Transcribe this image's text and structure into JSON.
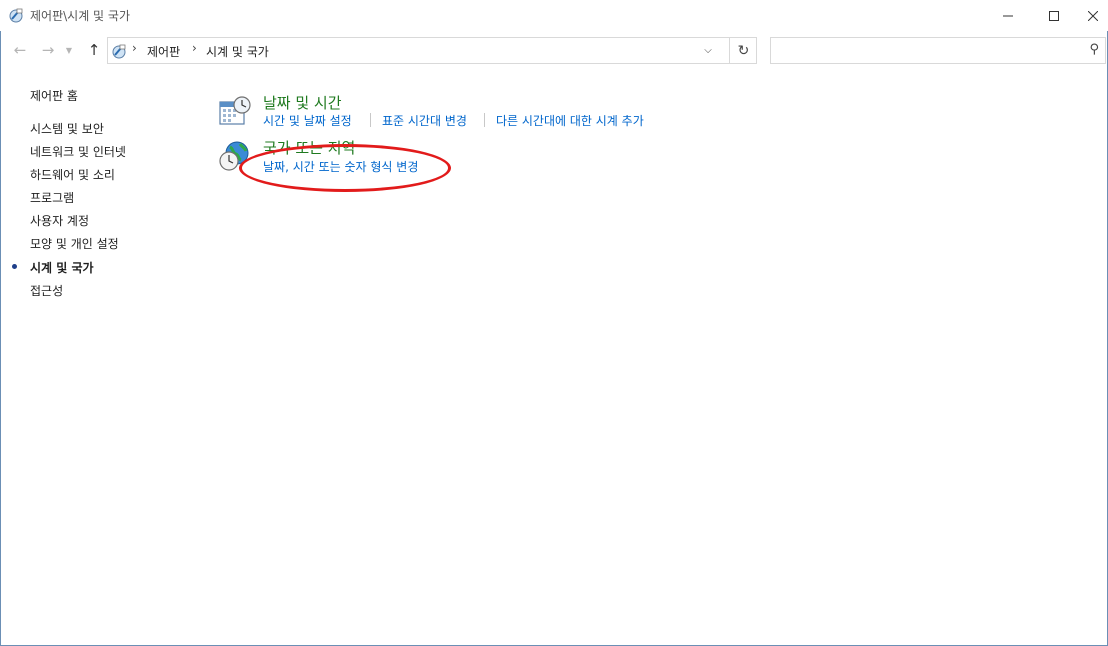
{
  "window": {
    "title": "제어판\\시계 및 국가"
  },
  "address": {
    "crumbs": [
      "제어판",
      "시계 및 국가"
    ],
    "separator": "›"
  },
  "search": {
    "placeholder": ""
  },
  "sidebar": {
    "home": "제어판 홈",
    "items": [
      {
        "label": "시스템 및 보안"
      },
      {
        "label": "네트워크 및 인터넷"
      },
      {
        "label": "하드웨어 및 소리"
      },
      {
        "label": "프로그램"
      },
      {
        "label": "사용자 계정"
      },
      {
        "label": "모양 및 개인 설정"
      },
      {
        "label": "시계 및 국가",
        "current": true
      },
      {
        "label": "접근성"
      }
    ]
  },
  "categories": [
    {
      "title": "날짜 및 시간",
      "icon": "calendar-clock-icon",
      "links": [
        "시간 및 날짜 설정",
        "표준 시간대 변경",
        "다른 시간대에 대한 시계 추가"
      ]
    },
    {
      "title": "국가 또는 지역",
      "icon": "globe-clock-icon",
      "links": [
        "날짜, 시간 또는 숫자 형식 변경"
      ]
    }
  ],
  "colors": {
    "category_title": "#1f7a1f",
    "link": "#0066cc",
    "annotation": "#e21b1b"
  }
}
